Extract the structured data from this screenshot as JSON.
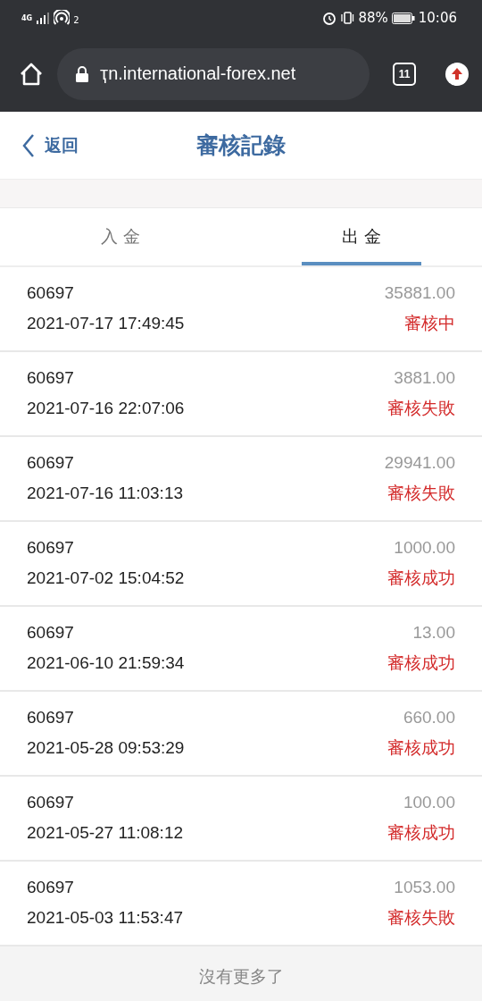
{
  "status_bar": {
    "network": "4G",
    "hotspot_count": "2",
    "battery": "88%",
    "time": "10:06"
  },
  "browser": {
    "url": "ҭn.international-forex.net",
    "tab_count": "11"
  },
  "header": {
    "back": "返回",
    "title": "審核記錄"
  },
  "tabs": [
    {
      "label": "入 金",
      "selected": false
    },
    {
      "label": "出 金",
      "selected": true
    }
  ],
  "records": [
    {
      "account": "60697",
      "amount": "35881.00",
      "time": "2021-07-17 17:49:45",
      "status": "審核中"
    },
    {
      "account": "60697",
      "amount": "3881.00",
      "time": "2021-07-16 22:07:06",
      "status": "審核失敗"
    },
    {
      "account": "60697",
      "amount": "29941.00",
      "time": "2021-07-16 11:03:13",
      "status": "審核失敗"
    },
    {
      "account": "60697",
      "amount": "1000.00",
      "time": "2021-07-02 15:04:52",
      "status": "審核成功"
    },
    {
      "account": "60697",
      "amount": "13.00",
      "time": "2021-06-10 21:59:34",
      "status": "審核成功"
    },
    {
      "account": "60697",
      "amount": "660.00",
      "time": "2021-05-28 09:53:29",
      "status": "審核成功"
    },
    {
      "account": "60697",
      "amount": "100.00",
      "time": "2021-05-27 11:08:12",
      "status": "審核成功"
    },
    {
      "account": "60697",
      "amount": "1053.00",
      "time": "2021-05-03 11:53:47",
      "status": "審核失敗"
    }
  ],
  "footer": "沒有更多了"
}
